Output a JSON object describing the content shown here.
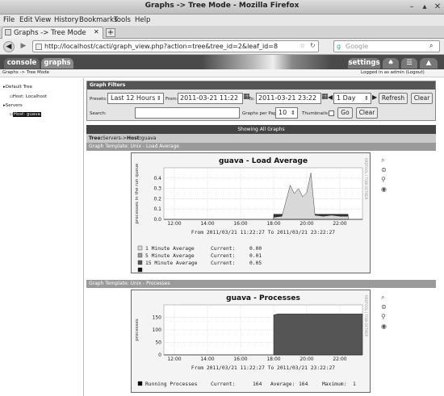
{
  "window": {
    "title": "Graphs -> Tree Mode - Mozilla Firefox"
  },
  "menu": [
    "File",
    "Edit",
    "View",
    "History",
    "Bookmarks",
    "Tools",
    "Help"
  ],
  "tab": {
    "label": "Graphs -> Tree Mode"
  },
  "url": "http://localhost/cacti/graph_view.php?action=tree&tree_id=2&leaf_id=8",
  "search": {
    "placeholder": "Google"
  },
  "cacti": {
    "tabs": {
      "console": "console",
      "graphs": "graphs",
      "settings": "settings"
    },
    "breadcrumb": "Graphs -> Tree Mode",
    "login": "Logged in as admin (Logout)"
  },
  "tree": {
    "items": [
      {
        "label": "Default Tree"
      },
      {
        "label": "Host: Localhost"
      },
      {
        "label": "Servers"
      },
      {
        "label": "Host: guava"
      }
    ]
  },
  "filters": {
    "title": "Graph Filters",
    "presets_label": "Presets:",
    "presets_value": "Last 12 Hours",
    "from_label": "From:",
    "from_value": "2011-03-21 11:22",
    "to_label": "To:",
    "to_value": "2011-03-21 23:22",
    "span_value": "1 Day",
    "refresh": "Refresh",
    "clear": "Clear",
    "search_label": "Search:",
    "search_value": "",
    "per_page_label": "Graphs per Page:",
    "per_page_value": "10",
    "thumbnails_label": "Thumbnails:",
    "go": "Go",
    "clear2": "Clear"
  },
  "showing": "Showing All Graphs",
  "tree_path": {
    "prefix": "Tree:",
    "path": "Servers->",
    "host_label": "Host:",
    "host": "guava"
  },
  "colors": {
    "accent_dark": "#444444",
    "graph_line": "#222222",
    "bg": "#ffffff"
  },
  "graphs": [
    {
      "template": "Graph Template: Unix - Load Average",
      "chart_data": {
        "type": "area",
        "title": "guava - Load Average",
        "ylabel": "processes in the run queue",
        "side_label": "RRDTOOL / TOBI OETIKER",
        "x_ticks": [
          "12:00",
          "14:00",
          "16:00",
          "18:00",
          "20:00",
          "22:00"
        ],
        "y_ticks": [
          "0.0",
          "0.1",
          "0.2",
          "0.3",
          "0.4"
        ],
        "ylim": [
          0,
          0.5
        ],
        "xrange": [
          "11:22",
          "23:22"
        ],
        "series": [
          {
            "name": "1 Minute Average",
            "color": "#d8d8d8",
            "x": [
              "18:00",
              "18:30",
              "19:00",
              "19:15",
              "19:30",
              "19:45",
              "20:00",
              "20:15",
              "20:30",
              "21:00",
              "21:30",
              "22:00",
              "22:30"
            ],
            "values": [
              0.02,
              0.03,
              0.33,
              0.25,
              0.3,
              0.22,
              0.26,
              0.45,
              0.04,
              0.03,
              0.04,
              0.03,
              0.03
            ]
          },
          {
            "name": "5 Minute Average",
            "color": "#9a9a9a",
            "x": [
              "18:00",
              "18:30",
              "19:00",
              "19:15",
              "19:30",
              "19:45",
              "20:00",
              "20:15",
              "20:30",
              "21:00",
              "21:30",
              "22:00",
              "22:30"
            ],
            "values": [
              0.02,
              0.02,
              0.15,
              0.12,
              0.14,
              0.11,
              0.12,
              0.2,
              0.03,
              0.02,
              0.03,
              0.02,
              0.02
            ]
          },
          {
            "name": "15 Minute Average",
            "color": "#333333",
            "x": [
              "18:00",
              "18:30",
              "19:00",
              "19:15",
              "19:30",
              "19:45",
              "20:00",
              "20:15",
              "20:30",
              "21:00",
              "21:30",
              "22:00",
              "22:30"
            ],
            "values": [
              0.05,
              0.05,
              0.06,
              0.06,
              0.06,
              0.06,
              0.06,
              0.07,
              0.05,
              0.05,
              0.05,
              0.05,
              0.05
            ]
          }
        ],
        "range_text": "From 2011/03/21 11:22:27 To 2011/03/21 23:22:27",
        "legend": [
          {
            "name": "1 Minute Average",
            "current_label": "Current:",
            "current": "0.00",
            "color": "#d8d8d8"
          },
          {
            "name": "5 Minute Average",
            "current_label": "Current:",
            "current": "0.01",
            "color": "#9a9a9a"
          },
          {
            "name": "15 Minute Average",
            "current_label": "Current:",
            "current": "0.05",
            "color": "#555555"
          },
          {
            "name": "",
            "current_label": "",
            "current": "",
            "color": "#111111"
          }
        ]
      }
    },
    {
      "template": "Graph Template: Unix - Processes",
      "chart_data": {
        "type": "area",
        "title": "guava - Processes",
        "ylabel": "processes",
        "side_label": "RRDTOOL / TOBI OETIKER",
        "x_ticks": [
          "12:00",
          "14:00",
          "16:00",
          "18:00",
          "20:00",
          "22:00"
        ],
        "y_ticks": [
          "0",
          "50",
          "100",
          "150"
        ],
        "ylim": [
          0,
          200
        ],
        "xrange": [
          "11:22",
          "23:22"
        ],
        "series": [
          {
            "name": "Running Processes",
            "color": "#555555",
            "x": [
              "18:00",
              "18:15",
              "19:00",
              "20:00",
              "21:00",
              "22:00",
              "23:22"
            ],
            "values": [
              160,
              164,
              164,
              164,
              164,
              164,
              164
            ]
          }
        ],
        "range_text": "From 2011/03/21 11:22:27 To 2011/03/21 23:22:27",
        "legend": [
          {
            "name": "Running Processes",
            "current_label": "Current:",
            "current": "164",
            "average_label": "Average:",
            "average": "164",
            "maximum_label": "Maximum:",
            "maximum": "1"
          }
        ]
      }
    }
  ]
}
